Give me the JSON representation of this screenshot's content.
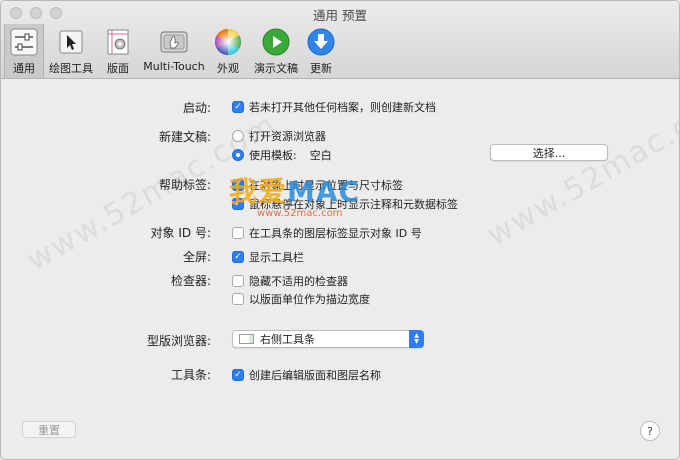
{
  "window": {
    "title": "通用 预置"
  },
  "toolbar": {
    "items": [
      {
        "label": "通用",
        "icon": "general-sliders-icon",
        "active": true
      },
      {
        "label": "绘图工具",
        "icon": "drawing-tools-cursor-icon",
        "active": false
      },
      {
        "label": "版面",
        "icon": "canvas-gear-icon",
        "active": false
      },
      {
        "label": "Multi-Touch",
        "icon": "multitouch-trackpad-icon",
        "active": false
      },
      {
        "label": "外观",
        "icon": "color-wheel-icon",
        "active": false
      },
      {
        "label": "演示文稿",
        "icon": "play-icon",
        "active": false
      },
      {
        "label": "更新",
        "icon": "download-arrow-icon",
        "active": false
      }
    ]
  },
  "prefs": {
    "startup": {
      "label": "启动:",
      "option": "若未打开其他任何档案，则创建新文档",
      "checked": true
    },
    "new_doc": {
      "label": "新建文稿:",
      "option_browser": "打开资源浏览器",
      "option_template": "使用模板:",
      "template_value": "空白",
      "choose_button": "选择...",
      "selected": "template"
    },
    "help_tags": {
      "label": "帮助标签:",
      "option_1": "在对象上时显示位置与尺寸标签",
      "option_2": "鼠标悬停在对象上时显示注释和元数据标签",
      "option_1_checked": true,
      "option_2_checked": true
    },
    "object_id": {
      "label": "对象 ID 号:",
      "option": "在工具条的图层标签显示对象 ID 号",
      "checked": false
    },
    "fullscreen": {
      "label": "全屏:",
      "option": "显示工具栏",
      "checked": true
    },
    "inspector": {
      "label": "检查器:",
      "option_1": "隐藏不适用的检查器",
      "option_2": "以版面单位作为描边宽度",
      "option_1_checked": false,
      "option_2_checked": false
    },
    "template_browser": {
      "label": "型版浏览器:",
      "value": "右侧工具条"
    },
    "toolbar_pref": {
      "label": "工具条:",
      "option": "创建后编辑版面和图层名称",
      "checked": true
    }
  },
  "footer": {
    "reset_button": "重置",
    "help_button": "?"
  },
  "watermark": {
    "side_text": "www.52mac.com",
    "brand_a": "我爱",
    "brand_b": "MAC",
    "url": "www.52mac.com"
  }
}
